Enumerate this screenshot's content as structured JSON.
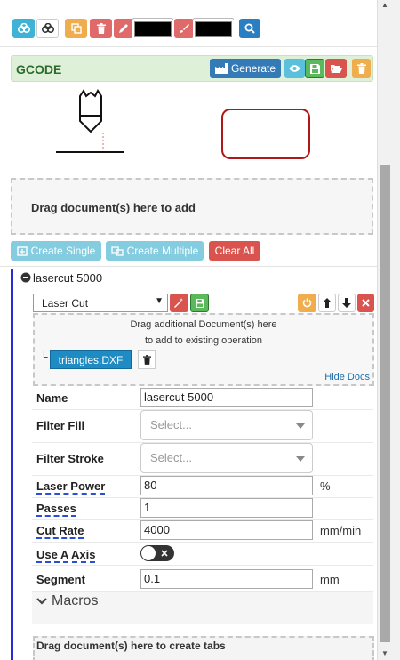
{
  "gcode": {
    "title": "GCODE",
    "generate_label": "Generate"
  },
  "colors": {
    "info": "#5bc0de",
    "warning": "#f0ad4e",
    "danger": "#d9534f",
    "primary": "#337ab7",
    "success": "#5cb85c",
    "accent_blue": "#1e8bc3"
  },
  "docs": {
    "drop_text": "Drag document(s) here to add",
    "create_single": "Create Single",
    "create_multiple": "Create Multiple",
    "clear_all": "Clear All"
  },
  "operation": {
    "title": "lasercut 5000",
    "type_selected": "Laser Cut",
    "drop_text_line1": "Drag additional Document(s) here",
    "drop_text_line2": "to add to existing operation",
    "doc_tree_glyph": "└",
    "doc_name": "triangles.DXF",
    "hide_docs": "Hide Docs",
    "fields": {
      "name_label": "Name",
      "name_value": "lasercut 5000",
      "filter_fill_label": "Filter Fill",
      "filter_fill_placeholder": "Select...",
      "filter_stroke_label": "Filter Stroke",
      "filter_stroke_placeholder": "Select...",
      "laser_power_label": "Laser Power",
      "laser_power_value": "80",
      "laser_power_unit": "%",
      "passes_label": "Passes",
      "passes_value": "1",
      "cut_rate_label": "Cut Rate",
      "cut_rate_value": "4000",
      "cut_rate_unit": "mm/min",
      "use_a_axis_label": "Use A Axis",
      "use_a_axis_on": false,
      "segment_label": "Segment",
      "segment_value": "0.1",
      "segment_unit": "mm"
    },
    "macros_label": "Macros",
    "tabs_drop_text": "Drag document(s) here to create tabs"
  }
}
